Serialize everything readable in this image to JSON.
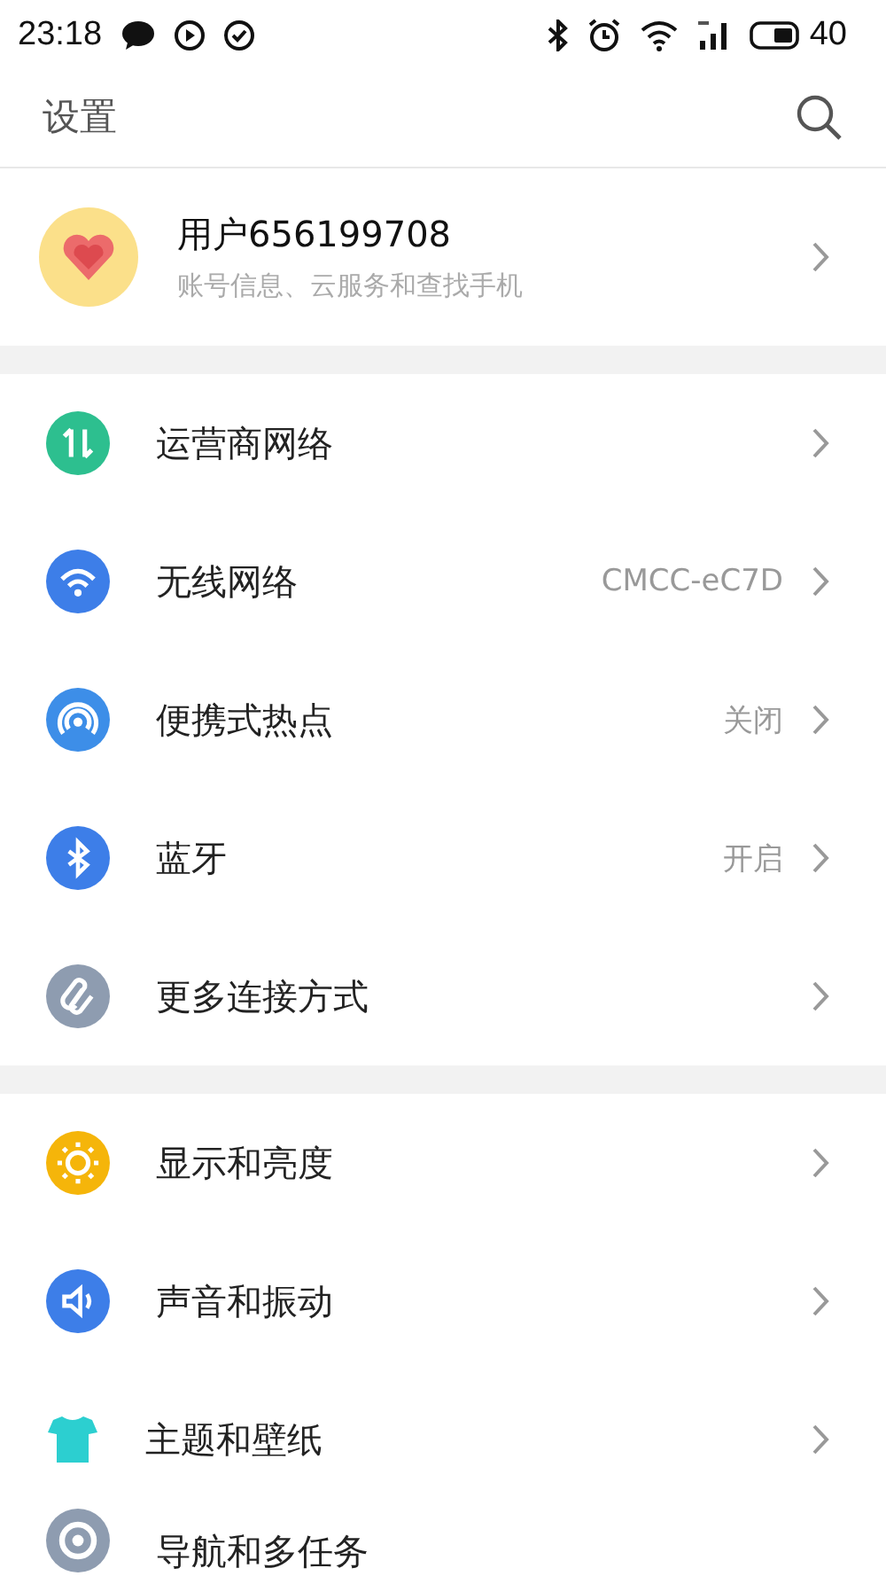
{
  "status_bar": {
    "time": "23:18",
    "battery": "40"
  },
  "header": {
    "title": "设置"
  },
  "account": {
    "name": "用户656199708",
    "subtitle": "账号信息、云服务和查找手机"
  },
  "groups": [
    {
      "items": [
        {
          "label": "运营商网络",
          "color": "#2dbf8f"
        },
        {
          "label": "无线网络",
          "value": "CMCC-eC7D",
          "color": "#3d7ee8"
        },
        {
          "label": "便携式热点",
          "value": "关闭",
          "color": "#3d8ee8"
        },
        {
          "label": "蓝牙",
          "value": "开启",
          "color": "#3d7ee8"
        },
        {
          "label": "更多连接方式",
          "color": "#8e9cb0"
        }
      ]
    },
    {
      "items": [
        {
          "label": "显示和亮度",
          "color": "#f5b50a"
        },
        {
          "label": "声音和振动",
          "color": "#3d7ee8"
        },
        {
          "label": "主题和壁纸",
          "color": "#2ccfd0"
        },
        {
          "label": "导航和多任务",
          "color": "#8e9cb0"
        }
      ]
    }
  ]
}
